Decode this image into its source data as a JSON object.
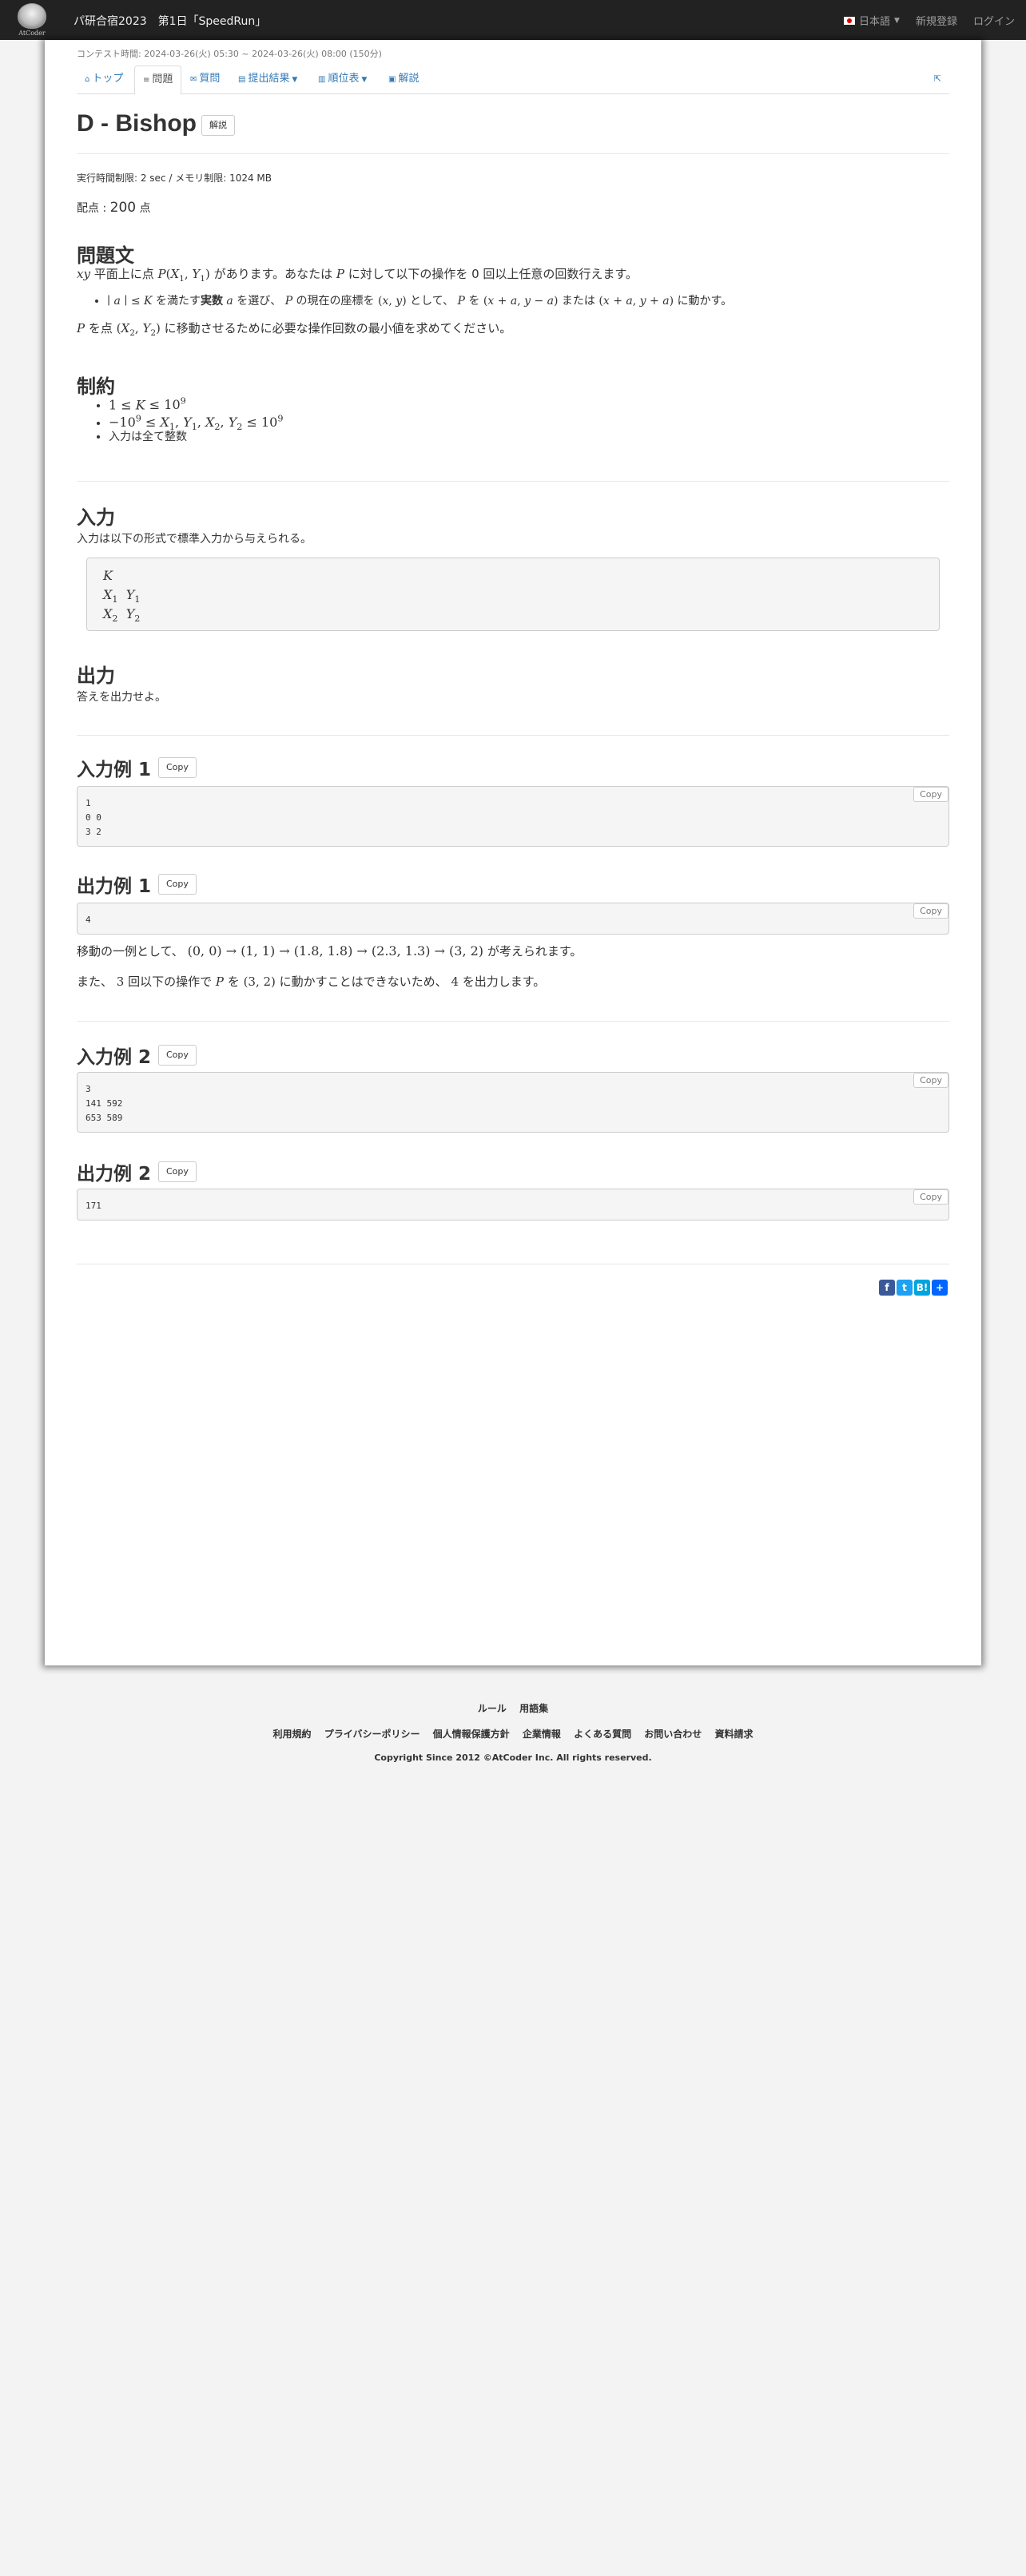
{
  "navbar": {
    "logo_text": "AtCoder",
    "contest_title": "パ研合宿2023　第1日「SpeedRun」",
    "language": "日本語",
    "signup": "新規登録",
    "login": "ログイン"
  },
  "contest_time": "コンテスト時間: 2024-03-26(火) 05:30 ~ 2024-03-26(火) 08:00 (150分)",
  "tabs": [
    {
      "label": "トップ",
      "icon": "home-icon"
    },
    {
      "label": "問題",
      "icon": "list-icon"
    },
    {
      "label": "質問",
      "icon": "comment-icon"
    },
    {
      "label": "提出結果",
      "icon": "submissions-icon"
    },
    {
      "label": "順位表",
      "icon": "standings-icon"
    },
    {
      "label": "解説",
      "icon": "book-icon"
    }
  ],
  "problem": {
    "title": "D - Bishop",
    "editorial_button": "解説",
    "limits": "実行時間制限: 2 sec / メモリ制限: 1024 MB",
    "score_label": "配点 : ",
    "score_value": "200",
    "score_unit": " 点"
  },
  "statement": {
    "heading": "問題文",
    "line1_pre": "平面上に点 ",
    "line1_mid": " があります。あなたは ",
    "line1_post": " に対して以下の操作を 0 回以上任意の回数行えます。",
    "bullet_pre": " を満たす",
    "bullet_bold": "実数",
    "bullet_mid": " を選び、",
    "bullet_mid2": " の現在の座標を ",
    "bullet_mid3": " として、",
    "bullet_mid4": " を ",
    "bullet_or": " または ",
    "bullet_post": " に動かす。",
    "line2_pre": " を点 ",
    "line2_post": " に移動させるために必要な操作回数の最小値を求めてください。"
  },
  "constraints": {
    "heading": "制約",
    "item3": "入力は全て整数"
  },
  "input": {
    "heading": "入力",
    "desc": "入力は以下の形式で標準入力から与えられる。"
  },
  "output": {
    "heading": "出力",
    "desc": "答えを出力せよ。"
  },
  "copy_label": "Copy",
  "samples": [
    {
      "heading": "入力例 1",
      "lines": [
        "1",
        "0 0",
        "3 2"
      ]
    },
    {
      "heading": "出力例 1",
      "lines": [
        "4"
      ]
    },
    {
      "heading": "入力例 2",
      "lines": [
        "3",
        "141 592",
        "653 589"
      ]
    },
    {
      "heading": "出力例 2",
      "lines": [
        "171"
      ]
    }
  ],
  "explanation": {
    "line1_pre": "移動の一例として、",
    "line1_post": " が考えられます。",
    "line2_pre": "また、",
    "line2_mid": " 回以下の操作で ",
    "line2_mid2": " を ",
    "line2_mid3": " に動かすことはできないため、",
    "line2_post": " を出力します。"
  },
  "share_icons": [
    "facebook-icon",
    "twitter-icon",
    "hatena-icon",
    "share-plus-icon"
  ],
  "footer": {
    "row1": [
      "ルール",
      "用語集"
    ],
    "row2": [
      "利用規約",
      "プライバシーポリシー",
      "個人情報保護方針",
      "企業情報",
      "よくある質問",
      "お問い合わせ",
      "資料請求"
    ],
    "copyright_pre": "Copyright Since 2012 ©",
    "copyright_brand": "AtCoder Inc.",
    "copyright_post": " All rights reserved."
  },
  "colors": {
    "navbar": "#222222",
    "link": "#337ab7",
    "page_bg": "#f3f3f3"
  }
}
